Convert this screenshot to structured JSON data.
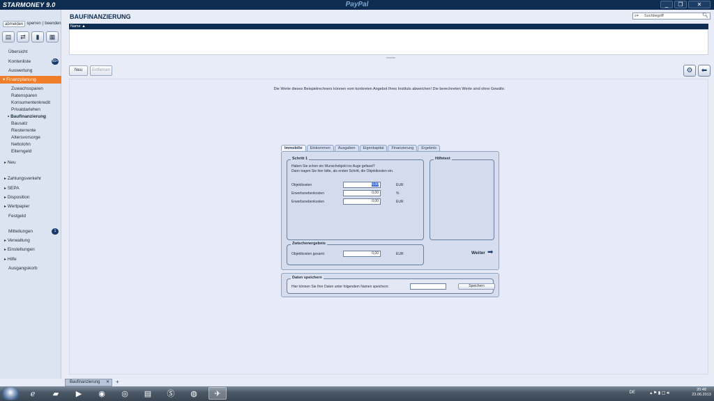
{
  "titlebar": {
    "logo": "STARMONEY 9.0",
    "center_brand": "PayPal",
    "minimize": "_",
    "restore": "❐",
    "close": "✕"
  },
  "sidebar": {
    "top_buttons": [
      "abmelden",
      "sperren",
      "beenden"
    ],
    "icons": [
      "accounts-icon",
      "transfer-icon",
      "chart-icon",
      "calculator-icon"
    ],
    "items": {
      "uebersicht": "Übersicht",
      "kontenliste": "Kontenliste",
      "kontenliste_badge": "50+",
      "auswertung": "Auswertung",
      "finanzplanung": "Finanzplanung",
      "neu": "Neu",
      "zahlungsverkehr": "Zahlungsverkehr",
      "sepa": "SEPA",
      "disposition": "Disposition",
      "wertpapier": "Wertpapier",
      "festgeld": "Festgeld",
      "mitteilungen": "Mitteilungen",
      "mitteilungen_badge": "1",
      "verwaltung": "Verwaltung",
      "einstellungen": "Einstellungen",
      "hilfe": "Hilfe",
      "ausgangskorb": "Ausgangskorb"
    },
    "sub": [
      "Zuwachssparen",
      "Ratensparen",
      "Konsumentenkredit",
      "Privatdarlehen",
      "Baufinanzierung",
      "Bausatz",
      "Riesterrente",
      "Altersvorsorge",
      "Nettolohn",
      "Elterngeld"
    ]
  },
  "main": {
    "title": "BAUFINANZIERUNG",
    "search_placeholder": "Suchbegriff",
    "table_column": "Name ▲",
    "btn_neu": "Neu",
    "btn_entfernen": "Entfernen",
    "disclaimer": "Die Werte dieses Beispielrechners können vom konkreten Angebot Ihres Instituts abweichen! Die berechneten Werte sind ohne Gewähr."
  },
  "calculator": {
    "tabs": [
      "Immobilie",
      "Einkommen",
      "Ausgaben",
      "Eigenkapital",
      "Finanzierung",
      "Ergebnis"
    ],
    "step1_title": "Schritt 1",
    "step1_text1": "Haben Sie schon ein Wunschobjekt ins Auge gefasst?",
    "step1_text2": "Dann tragen Sie hier bitte, als ersten Schritt, die Objektkosten ein.",
    "rows": [
      {
        "label": "Objektkosten",
        "value": "0,00",
        "unit": "EUR"
      },
      {
        "label": "Erwerbsnebenkosten",
        "value": "0,00",
        "unit": "%"
      },
      {
        "label": "Erwerbsnebenkosten",
        "value": "0,00",
        "unit": "EUR"
      }
    ],
    "hilfetext_title": "Hilfetext",
    "zwischen_title": "Zwischenergebnis",
    "zwischen_label": "Objektkosten gesamt",
    "zwischen_value": "0,00",
    "zwischen_unit": "EUR",
    "weiter": "Weiter",
    "save_title": "Daten speichern",
    "save_text": "Hier können Sie Ihre Daten unter folgendem Namen speichern:",
    "save_button": "Speichern"
  },
  "bottom": {
    "doc_tab": "Baufinanzierung",
    "add": "+"
  },
  "taskbar": {
    "lang": "DE",
    "time": "20:48",
    "date": "23.06.2013"
  }
}
